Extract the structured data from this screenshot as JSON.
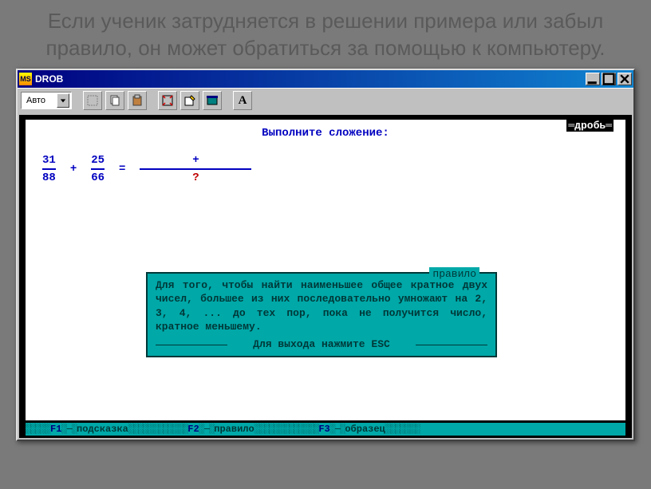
{
  "slide": {
    "title": "Если ученик затрудняется в решении примера или забыл правило, он может обратиться за помощью к компьютеру."
  },
  "window": {
    "title": "DROB",
    "min_label": "_",
    "max_label": "□",
    "close_label": "×"
  },
  "toolbar": {
    "dropdown_value": "Авто",
    "font_button": "A"
  },
  "dos": {
    "frame_label": "дробь",
    "prompt": "Выполните сложение:",
    "fraction1": {
      "num": "31",
      "den": "88"
    },
    "op1": "+",
    "fraction2": {
      "num": "25",
      "den": "66"
    },
    "eq": "=",
    "result": {
      "num": "+",
      "den": "?"
    },
    "rule": {
      "title": "правило",
      "body": "Для того, чтобы найти наименьшее общее кратное двух чисел, большее из них последовательно умножают на 2, 3, 4, ... до тех пор, пока не получится число, кратное меньшему.",
      "footer": "Для выхода нажмите ESC"
    },
    "status": {
      "f1_key": "F1",
      "f1_label": "подсказка",
      "f2_key": "F2",
      "f2_label": "правило",
      "f3_key": "F3",
      "f3_label": "образец"
    }
  }
}
